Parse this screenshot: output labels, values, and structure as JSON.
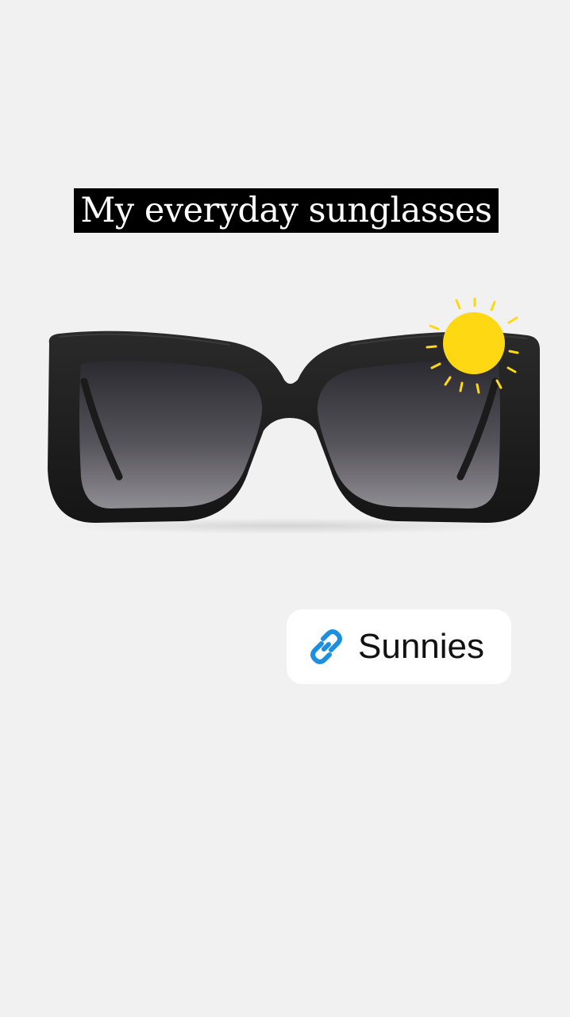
{
  "story": {
    "caption": "My everyday sunglasses",
    "link_sticker": {
      "label": "Sunnies",
      "icon": "link-icon"
    },
    "decoration_icon": "sun-icon",
    "product_image": "black cat-eye sunglasses with gradient grey lenses"
  },
  "colors": {
    "background": "#f1f1f1",
    "caption_bg": "#000000",
    "caption_text": "#ffffff",
    "sun": "#ffd814",
    "link_icon": "#1d8fe1"
  }
}
